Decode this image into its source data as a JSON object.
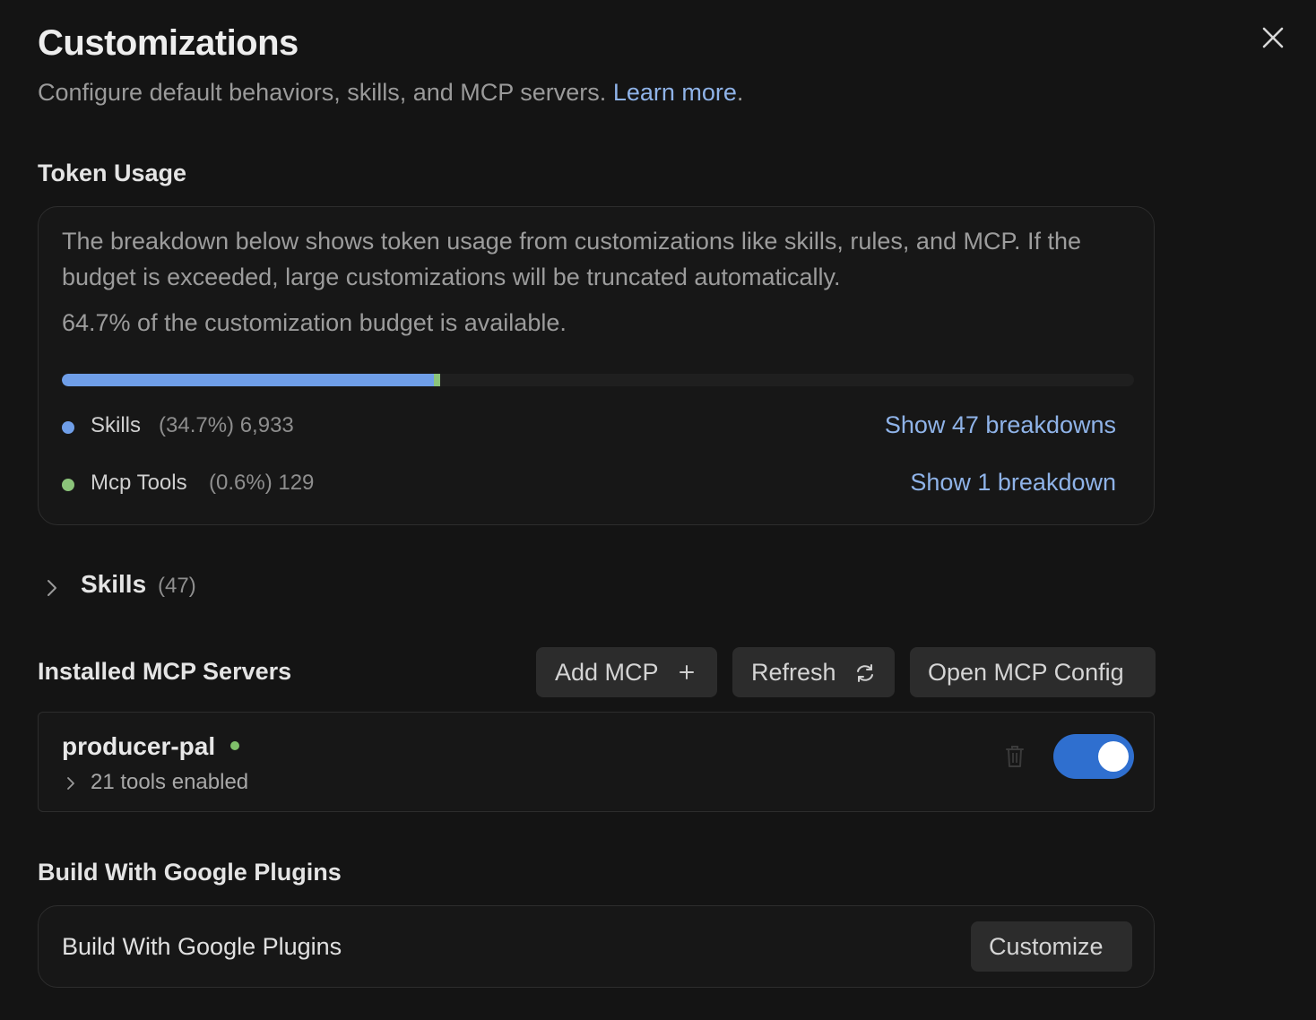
{
  "header": {
    "title": "Customizations",
    "subtitle": "Configure default behaviors, skills, and MCP servers.",
    "learn_more": "Learn more",
    "period": ".",
    "close_icon": "close-icon"
  },
  "token_usage": {
    "heading": "Token Usage",
    "description": "The breakdown below shows token usage from customizations like skills, rules, and MCP. If the budget is exceeded, large customizations will be truncated automatically.",
    "available_text": "64.7% of the customization budget is available.",
    "budget_available_percent": 64.7,
    "segments": [
      {
        "name": "Skills",
        "stats": "(34.7%) 6,933",
        "percent": 34.7,
        "color": "#6f9ee8",
        "link": "Show 47 breakdowns"
      },
      {
        "name": "Mcp Tools",
        "stats": "(0.6%) 129",
        "percent": 0.6,
        "color": "#8bc47a",
        "link": "Show 1 breakdown"
      }
    ]
  },
  "skills_section": {
    "label": "Skills",
    "count": "(47)",
    "icon": "chevron-right-icon"
  },
  "mcp": {
    "heading": "Installed MCP Servers",
    "buttons": {
      "add": "Add MCP",
      "add_icon": "plus-icon",
      "refresh": "Refresh",
      "refresh_icon": "refresh-icon",
      "open_config": "Open MCP Config"
    },
    "servers": [
      {
        "name": "producer-pal",
        "status_color": "#7fbf6a",
        "tools": "21 tools enabled",
        "enabled": true,
        "toggle_color": "#2f6fcf",
        "trash_icon": "trash-icon"
      }
    ]
  },
  "plugins": {
    "heading": "Build With Google Plugins",
    "item_label": "Build With Google Plugins",
    "customize": "Customize"
  }
}
